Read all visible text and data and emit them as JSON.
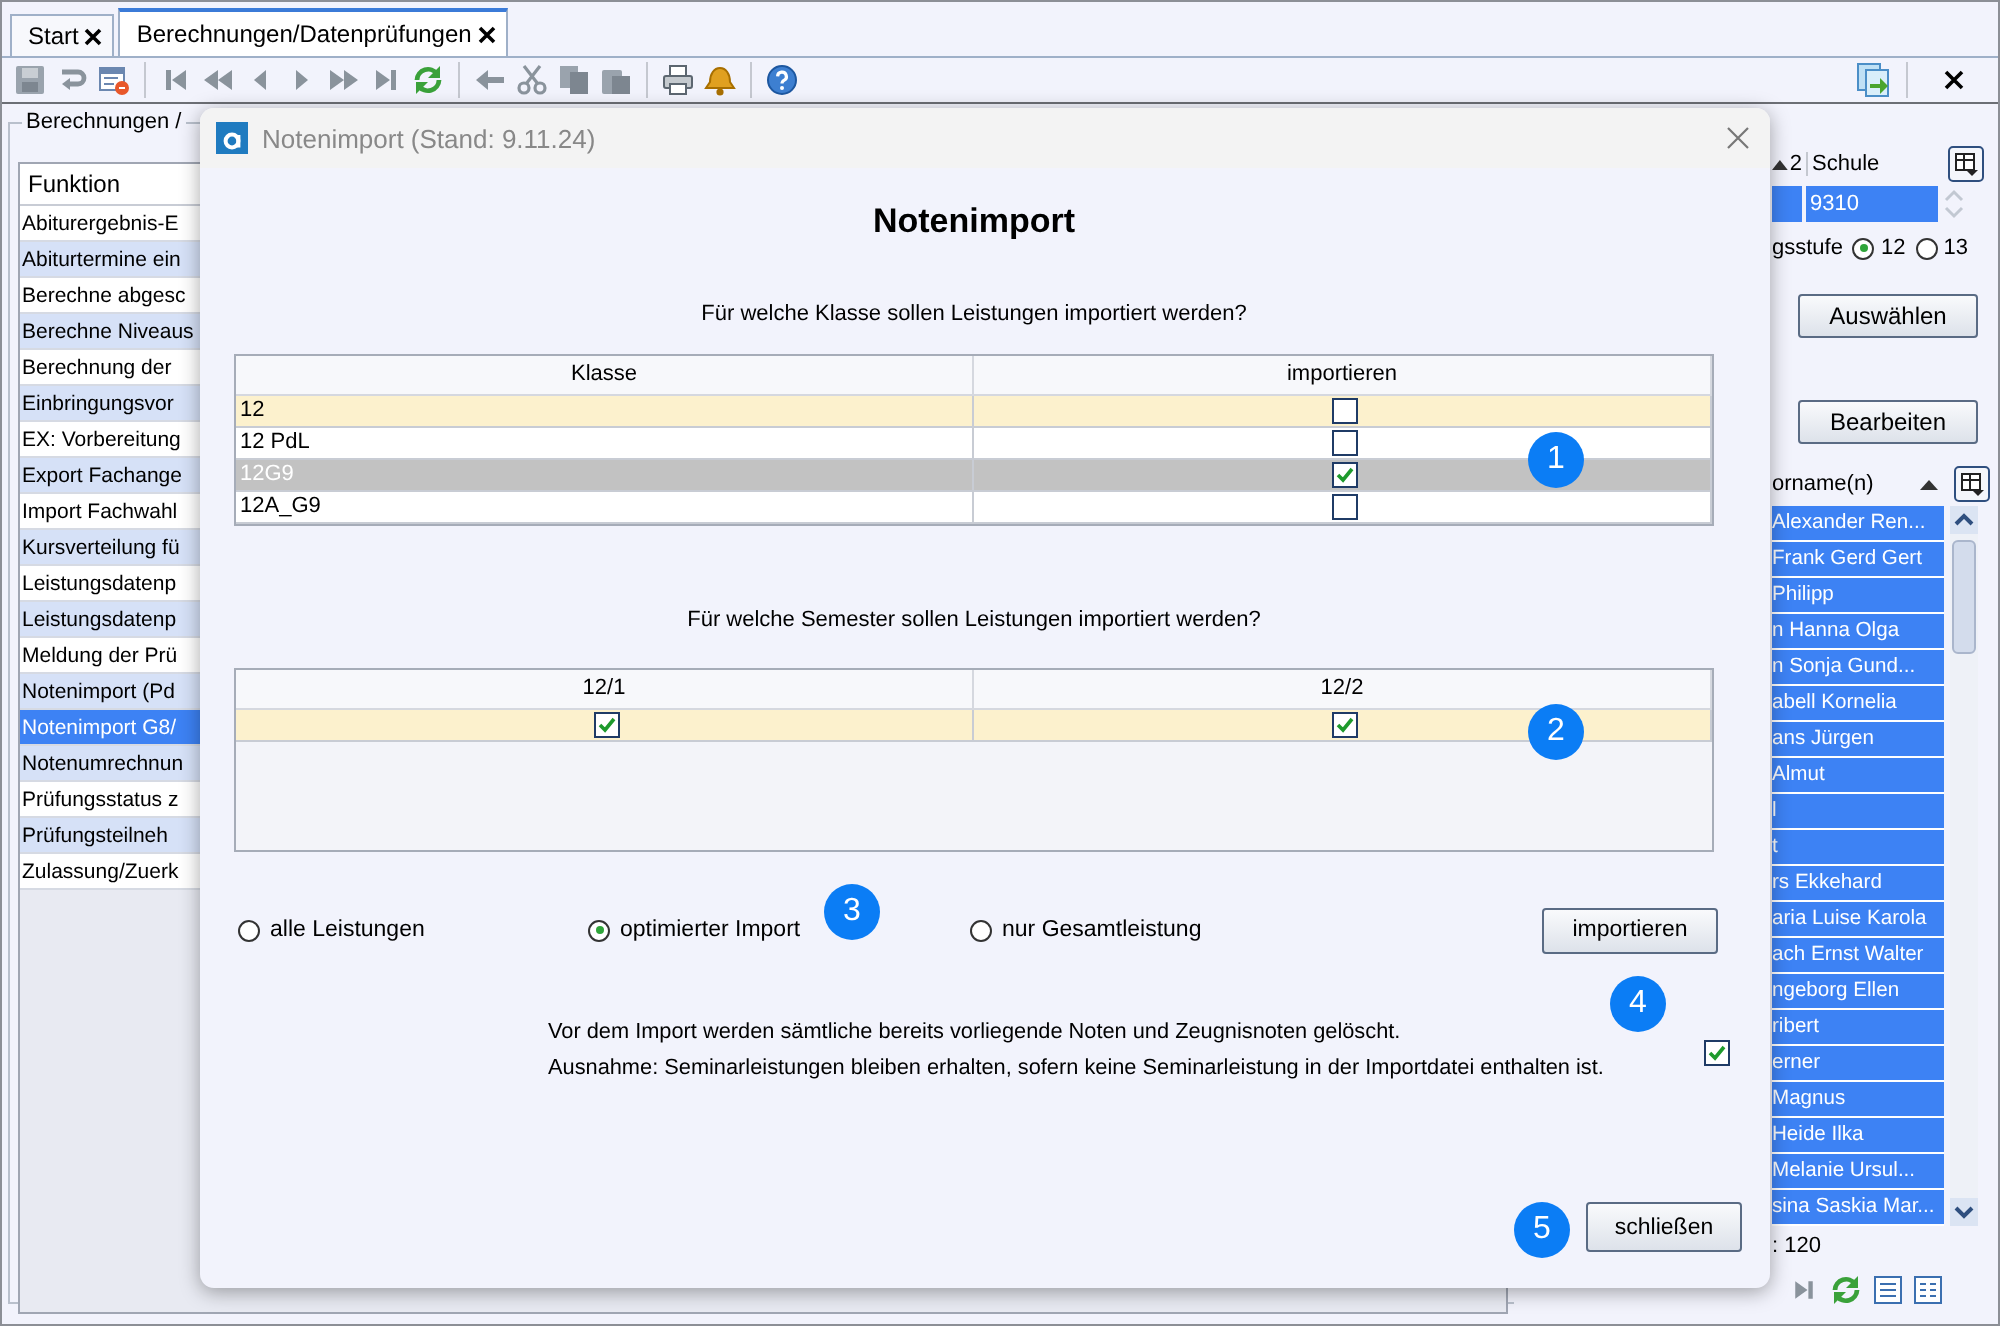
{
  "tabs": [
    {
      "label": "Start",
      "selected": false
    },
    {
      "label": "Berechnungen/Datenprüfungen",
      "selected": true
    }
  ],
  "left_panel": {
    "group_title": "Berechnungen /",
    "column": "Funktion",
    "rows": [
      {
        "label": "Abiturergebnis-E",
        "selected": false
      },
      {
        "label": "Abiturtermine ein",
        "selected": false
      },
      {
        "label": "Berechne abgesc",
        "selected": false
      },
      {
        "label": "Berechne Niveaus",
        "selected": false
      },
      {
        "label": "Berechnung der",
        "selected": false
      },
      {
        "label": "Einbringungsvor",
        "selected": false
      },
      {
        "label": "EX: Vorbereitung",
        "selected": false
      },
      {
        "label": "Export Fachange",
        "selected": false
      },
      {
        "label": "Import Fachwahl",
        "selected": false
      },
      {
        "label": "Kursverteilung fü",
        "selected": false
      },
      {
        "label": "Leistungsdatenp",
        "selected": false
      },
      {
        "label": "Leistungsdatenp",
        "selected": false
      },
      {
        "label": "Meldung der Prü",
        "selected": false
      },
      {
        "label": "Notenimport (Pd",
        "selected": false
      },
      {
        "label": "Notenimport G8/",
        "selected": true
      },
      {
        "label": "Notenumrechnun",
        "selected": false
      },
      {
        "label": "Prüfungsstatus z",
        "selected": false
      },
      {
        "label": "Prüfungsteilneh",
        "selected": false
      },
      {
        "label": "Zulassung/Zuerk",
        "selected": false
      }
    ]
  },
  "right_panel": {
    "school_table": {
      "sort_index": "2",
      "column": "Schule",
      "value": "9310"
    },
    "grade_label": "gsstufe",
    "grades": [
      {
        "label": "12",
        "selected": true
      },
      {
        "label": "13",
        "selected": false
      }
    ],
    "buttons": [
      "Auswählen",
      "Bearbeiten"
    ],
    "names_column": "orname(n)",
    "names": [
      "Alexander Ren...",
      "Frank Gerd Gert",
      "Philipp",
      "n Hanna Olga",
      "n Sonja Gund...",
      "abell Kornelia",
      "ans Jürgen",
      "Almut",
      "l",
      "t",
      "rs Ekkehard",
      "aria Luise Karola",
      "ach Ernst Walter",
      "ngeborg Ellen",
      "ribert",
      "erner",
      "Magnus",
      "Heide Ilka",
      "Melanie Ursul...",
      "sina Saskia Mar..."
    ],
    "count": ": 120"
  },
  "dialog": {
    "title": "Notenimport (Stand: 9.11.24)",
    "heading": "Notenimport",
    "class_question": "Für welche Klasse sollen Leistungen importiert werden?",
    "class_table": {
      "columns": [
        "Klasse",
        "importieren"
      ],
      "marker": "1",
      "rows": [
        {
          "klasse": "12",
          "checked": false,
          "current": true,
          "selected": false
        },
        {
          "klasse": "12 PdL",
          "checked": false,
          "current": false,
          "selected": false
        },
        {
          "klasse": "12G9",
          "checked": true,
          "current": false,
          "selected": true
        },
        {
          "klasse": "12A_G9",
          "checked": false,
          "current": false,
          "selected": false
        }
      ]
    },
    "semester_question": "Für welche Semester sollen Leistungen importiert werden?",
    "semester_table": {
      "marker": "2",
      "columns": [
        {
          "label": "12/1",
          "checked": true
        },
        {
          "label": "12/2",
          "checked": true
        }
      ]
    },
    "import_mode": {
      "marker": "3",
      "options": [
        {
          "label": "alle Leistungen",
          "selected": false
        },
        {
          "label": "optimierter Import",
          "selected": true
        },
        {
          "label": "nur Gesamtleistung",
          "selected": false
        }
      ]
    },
    "import_button": "importieren",
    "delete_note": {
      "marker": "4",
      "lines": [
        "Vor dem Import werden sämtliche bereits vorliegende Noten und Zeugnisnoten gelöscht.",
        "Ausnahme: Seminarleistungen bleiben erhalten, sofern keine Seminarleistung in der Importdatei enthalten ist."
      ],
      "checked": true
    },
    "close_button": {
      "label": "schließen",
      "marker": "5"
    }
  }
}
